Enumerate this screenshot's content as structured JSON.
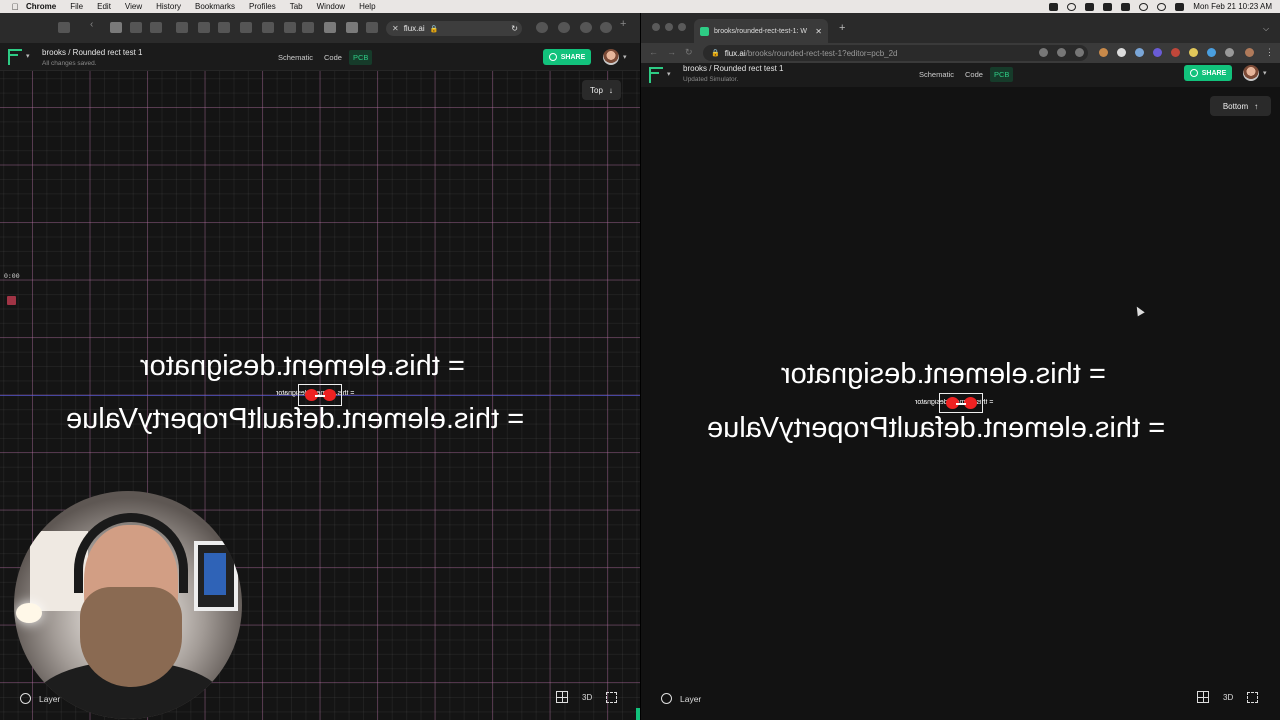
{
  "menubar": {
    "apple": "",
    "items": [
      "Chrome",
      "File",
      "Edit",
      "View",
      "History",
      "Bookmarks",
      "Profiles",
      "Tab",
      "Window",
      "Help"
    ],
    "clock": "Mon Feb 21  10:23 AM"
  },
  "left": {
    "url": "flux.ai",
    "project_title": "brooks / Rounded rect test 1",
    "project_status": "All changes saved.",
    "tabs": [
      "Schematic",
      "Code",
      "PCB"
    ],
    "active_tab": "PCB",
    "share_label": "SHARE",
    "view_label": "Top",
    "timer": "0:00",
    "designator_text": "= this.element.designator",
    "value_text": "= this.element.defaultPropertyValue",
    "small_label": "= this.element.designator",
    "layer_label": "Layer",
    "view3d_label": "3D"
  },
  "right": {
    "tab_title": "brooks/rounded-rect-test-1: W",
    "url_host": "flux.ai",
    "url_path": "/brooks/rounded-rect-test-1?editor=pcb_2d",
    "project_title": "brooks / Rounded rect test 1",
    "project_status": "Updated Simulator.",
    "tabs": [
      "Schematic",
      "Code",
      "PCB"
    ],
    "active_tab": "PCB",
    "share_label": "SHARE",
    "view_label": "Bottom",
    "designator_text": "= this.element.designator",
    "value_text": "= this.element.defaultPropertyValue",
    "small_label": "= this.element.designator",
    "layer_label": "Layer",
    "view3d_label": "3D"
  },
  "colors": {
    "accent": "#12c27c",
    "pad_red": "#e22222",
    "grid_pink": "#be6eaa"
  }
}
